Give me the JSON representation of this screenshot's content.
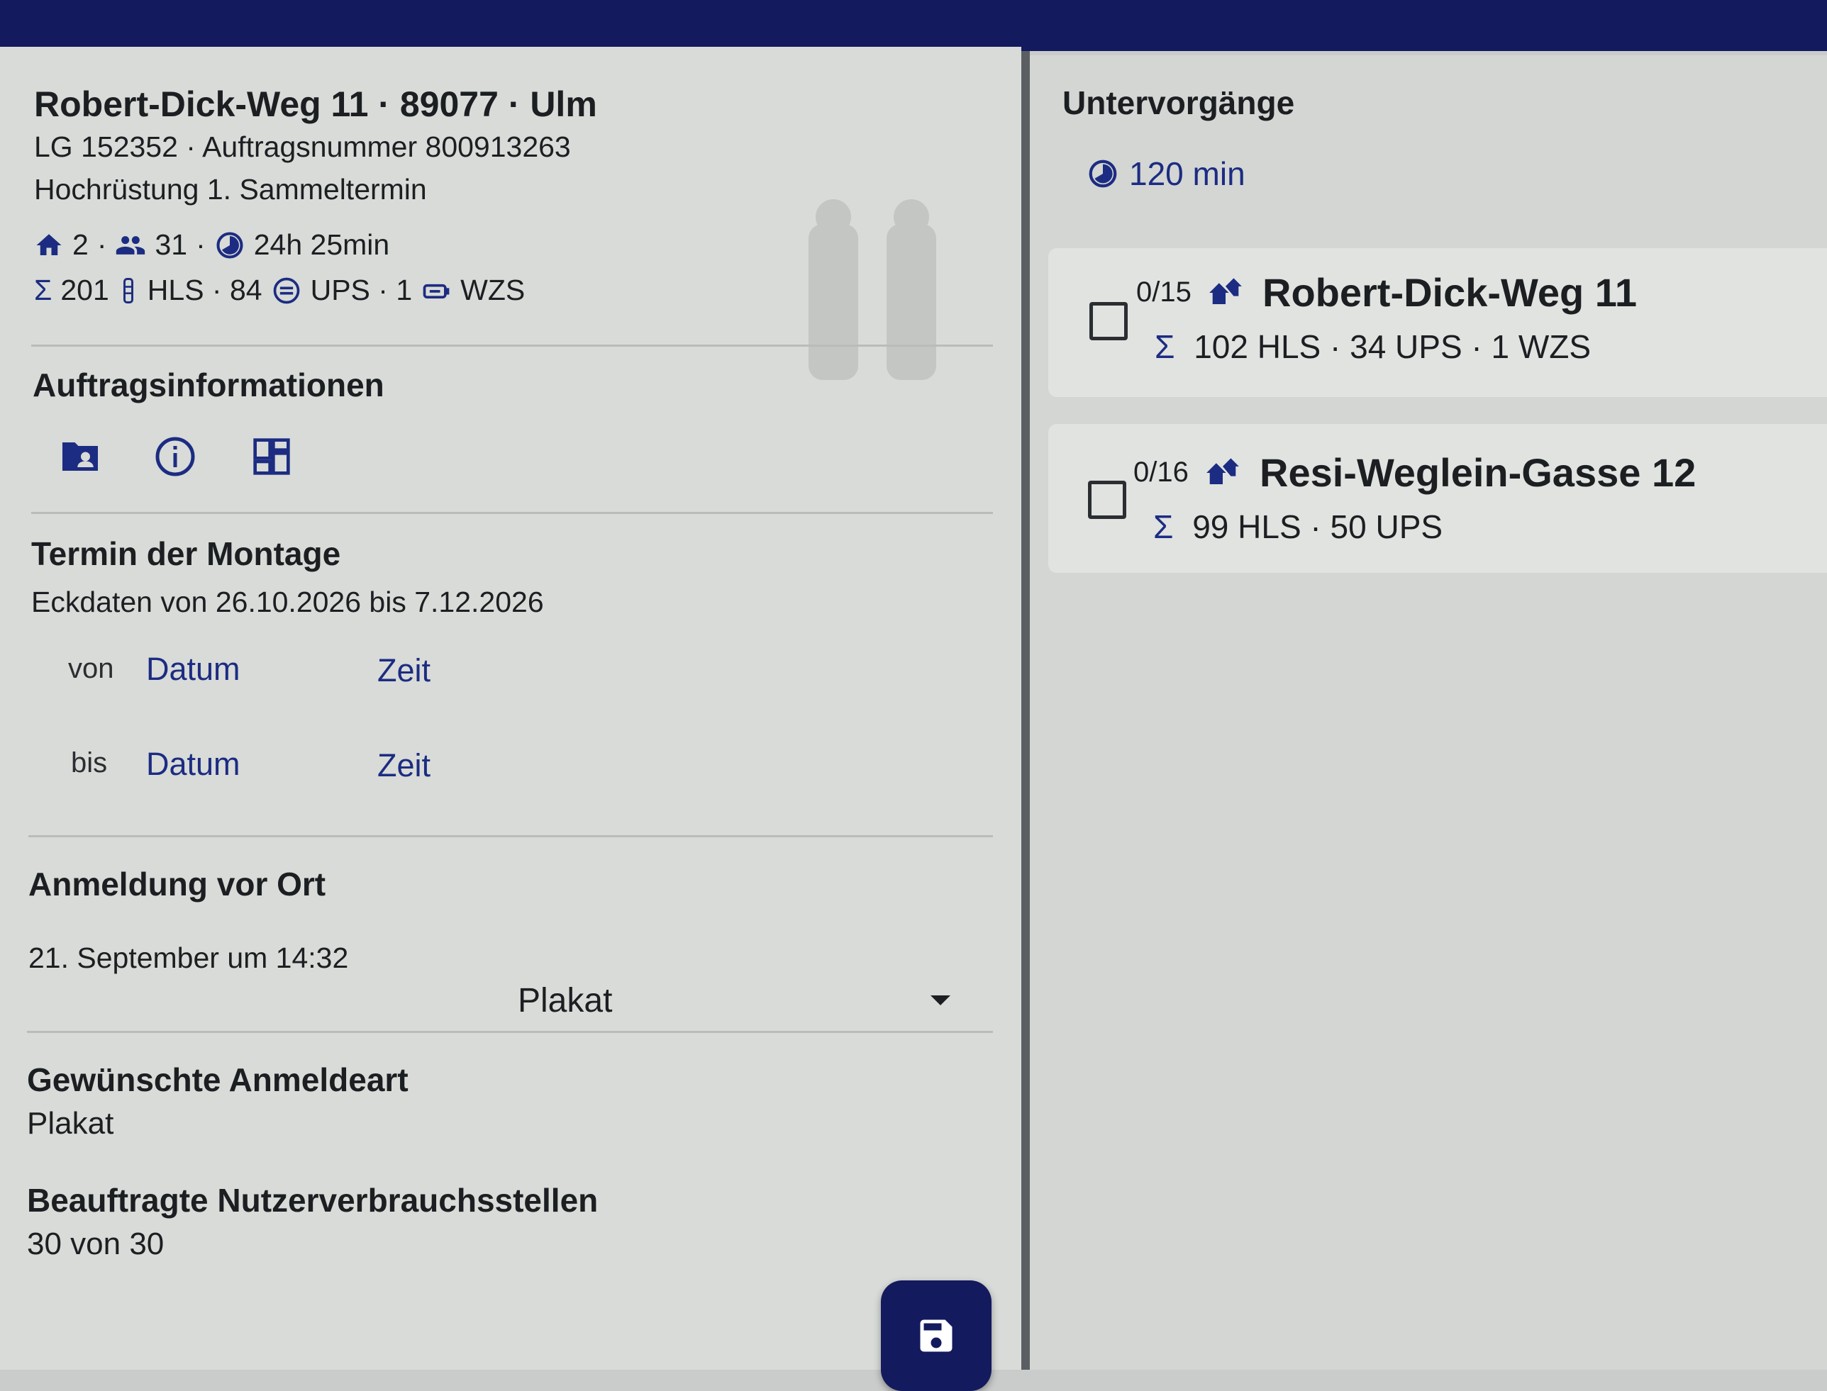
{
  "header": {
    "address": "Robert-Dick-Weg 11 · 89077 · Ulm",
    "order_line": "LG 152352 · Auftragsnummer 800913263",
    "subtitle": "Hochrüstung 1. Sammeltermin",
    "stats1": {
      "houses": "2",
      "persons": "31",
      "duration": "24h 25min"
    },
    "stats2": {
      "sum": "201",
      "hls": "HLS · 84",
      "ups": "UPS · 1",
      "wzs": "WZS"
    }
  },
  "auftrag": {
    "heading": "Auftragsinformationen",
    "icons": [
      "folder-account-icon",
      "info-icon",
      "dashboard-icon"
    ]
  },
  "termin": {
    "heading": "Termin der Montage",
    "eckdaten": "Eckdaten von 26.10.2026 bis 7.12.2026",
    "von_label": "von",
    "bis_label": "bis",
    "datum": "Datum",
    "zeit": "Zeit"
  },
  "anmeldung": {
    "heading": "Anmeldung vor Ort",
    "date": "21. September um 14:32",
    "select_value": "Plakat"
  },
  "gewuenscht": {
    "heading": "Gewünschte Anmeldeart",
    "value": "Plakat"
  },
  "beauftragt": {
    "heading": "Beauftragte Nutzerverbrauchsstellen",
    "value": "30 von 30"
  },
  "right": {
    "heading": "Untervorgänge",
    "duration": "120 min",
    "cards": [
      {
        "count": "0/15",
        "title": "Robert-Dick-Weg 11",
        "sum": "102 HLS · 34 UPS · 1 WZS"
      },
      {
        "count": "0/16",
        "title": "Resi-Weglein-Gasse 12",
        "sum": "99 HLS · 50 UPS"
      }
    ]
  },
  "colors": {
    "brand": "#141a5e",
    "link": "#1c2c82"
  }
}
